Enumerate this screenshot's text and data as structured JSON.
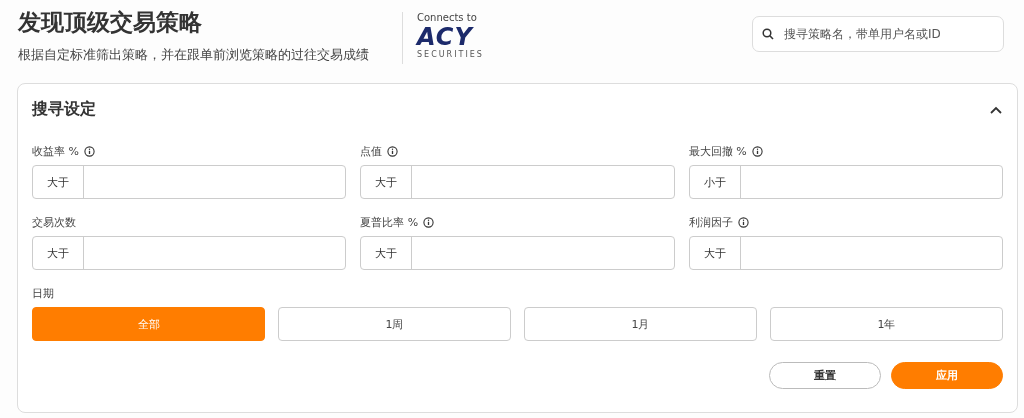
{
  "header": {
    "title": "发现顶级交易策略",
    "subtitle": "根据自定标准筛出策略，并在跟单前浏览策略的过往交易成绩"
  },
  "logo": {
    "caption": "Connects to",
    "wordmark": "ACY",
    "tagline": "SECURITIES"
  },
  "search": {
    "placeholder": "搜寻策略名，带单用户名或ID"
  },
  "panel": {
    "title": "搜寻设定",
    "expanded": true,
    "filters": [
      {
        "label": "收益率 %",
        "info": true,
        "operator": "大于"
      },
      {
        "label": "点值",
        "info": true,
        "operator": "大于"
      },
      {
        "label": "最大回撤 %",
        "info": true,
        "operator": "小于"
      },
      {
        "label": "交易次数",
        "info": false,
        "operator": "大于"
      },
      {
        "label": "夏普比率 %",
        "info": true,
        "operator": "大于"
      },
      {
        "label": "利润因子",
        "info": true,
        "operator": "大于"
      }
    ],
    "date": {
      "label": "日期",
      "options": [
        {
          "label": "全部",
          "selected": true
        },
        {
          "label": "1周",
          "selected": false
        },
        {
          "label": "1月",
          "selected": false
        },
        {
          "label": "1年",
          "selected": false
        }
      ]
    },
    "buttons": [
      {
        "label": "重置",
        "kind": "secondary"
      },
      {
        "label": "应用",
        "kind": "primary"
      }
    ]
  }
}
